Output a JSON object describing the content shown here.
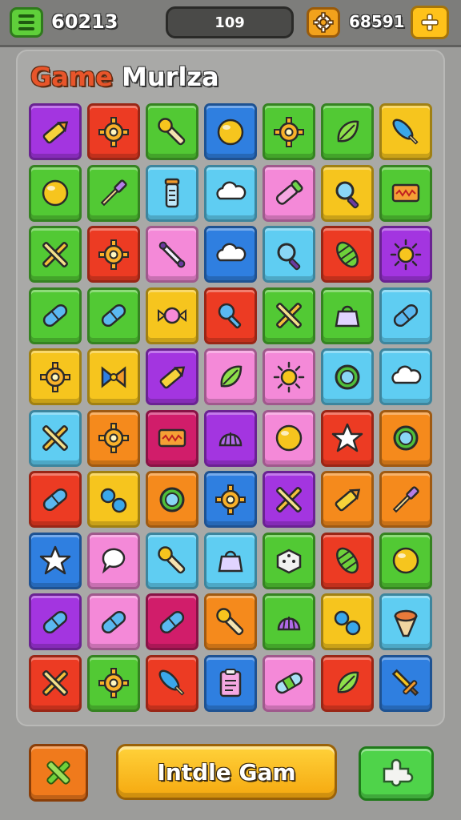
{
  "header": {
    "score_left": "60213",
    "center_value": "109",
    "score_right": "68591"
  },
  "title": {
    "word1": "Game",
    "word2": "Murlza"
  },
  "colors": {
    "purple": "#a335e0",
    "red": "#ec3b23",
    "green": "#52c934",
    "blue": "#2f7fe0",
    "yellow": "#f6c51e",
    "orange": "#f58a1c",
    "lightblue": "#5fcdf2",
    "pink": "#f489d8",
    "magenta": "#d11d6a"
  },
  "grid": [
    [
      {
        "c": "purple",
        "i": "crayon"
      },
      {
        "c": "red",
        "i": "gear"
      },
      {
        "c": "green",
        "i": "wrench"
      },
      {
        "c": "blue",
        "i": "orb"
      },
      {
        "c": "green",
        "i": "gear"
      },
      {
        "c": "green",
        "i": "leaf"
      },
      {
        "c": "yellow",
        "i": "feather"
      }
    ],
    [
      {
        "c": "green",
        "i": "orb"
      },
      {
        "c": "green",
        "i": "brush"
      },
      {
        "c": "lightblue",
        "i": "vial"
      },
      {
        "c": "lightblue",
        "i": "cloud"
      },
      {
        "c": "pink",
        "i": "tube"
      },
      {
        "c": "yellow",
        "i": "magnifier"
      },
      {
        "c": "green",
        "i": "card"
      }
    ],
    [
      {
        "c": "green",
        "i": "swords"
      },
      {
        "c": "red",
        "i": "gear"
      },
      {
        "c": "pink",
        "i": "stick"
      },
      {
        "c": "blue",
        "i": "cloud"
      },
      {
        "c": "lightblue",
        "i": "magnifier"
      },
      {
        "c": "red",
        "i": "melon"
      },
      {
        "c": "purple",
        "i": "sun"
      }
    ],
    [
      {
        "c": "green",
        "i": "capsule"
      },
      {
        "c": "green",
        "i": "capsule"
      },
      {
        "c": "yellow",
        "i": "candy"
      },
      {
        "c": "red",
        "i": "rattle"
      },
      {
        "c": "green",
        "i": "swords"
      },
      {
        "c": "green",
        "i": "bag"
      },
      {
        "c": "lightblue",
        "i": "capsule"
      }
    ],
    [
      {
        "c": "yellow",
        "i": "gear"
      },
      {
        "c": "yellow",
        "i": "bow"
      },
      {
        "c": "purple",
        "i": "crayon"
      },
      {
        "c": "pink",
        "i": "leaf"
      },
      {
        "c": "pink",
        "i": "sun"
      },
      {
        "c": "lightblue",
        "i": "ring"
      },
      {
        "c": "lightblue",
        "i": "cloud"
      }
    ],
    [
      {
        "c": "lightblue",
        "i": "swords"
      },
      {
        "c": "orange",
        "i": "gear"
      },
      {
        "c": "magenta",
        "i": "card"
      },
      {
        "c": "purple",
        "i": "shell"
      },
      {
        "c": "pink",
        "i": "orb"
      },
      {
        "c": "red",
        "i": "star"
      },
      {
        "c": "orange",
        "i": "ring"
      }
    ],
    [
      {
        "c": "red",
        "i": "capsule"
      },
      {
        "c": "yellow",
        "i": "dots"
      },
      {
        "c": "orange",
        "i": "ring"
      },
      {
        "c": "blue",
        "i": "gear"
      },
      {
        "c": "purple",
        "i": "swords"
      },
      {
        "c": "orange",
        "i": "crayon"
      },
      {
        "c": "orange",
        "i": "brush"
      }
    ],
    [
      {
        "c": "blue",
        "i": "star"
      },
      {
        "c": "pink",
        "i": "bubble"
      },
      {
        "c": "lightblue",
        "i": "wrench"
      },
      {
        "c": "lightblue",
        "i": "bag"
      },
      {
        "c": "green",
        "i": "dice"
      },
      {
        "c": "red",
        "i": "melon"
      },
      {
        "c": "green",
        "i": "orb"
      }
    ],
    [
      {
        "c": "purple",
        "i": "capsule"
      },
      {
        "c": "pink",
        "i": "capsule"
      },
      {
        "c": "magenta",
        "i": "capsule"
      },
      {
        "c": "orange",
        "i": "wrench"
      },
      {
        "c": "green",
        "i": "shell"
      },
      {
        "c": "yellow",
        "i": "dots"
      },
      {
        "c": "lightblue",
        "i": "cone"
      }
    ],
    [
      {
        "c": "red",
        "i": "swords"
      },
      {
        "c": "green",
        "i": "gear"
      },
      {
        "c": "red",
        "i": "feather"
      },
      {
        "c": "blue",
        "i": "clipboard"
      },
      {
        "c": "pink",
        "i": "bandage"
      },
      {
        "c": "red",
        "i": "leaf"
      },
      {
        "c": "blue",
        "i": "sword"
      }
    ]
  ],
  "buttons": {
    "main_label": "Intdle Gam"
  }
}
